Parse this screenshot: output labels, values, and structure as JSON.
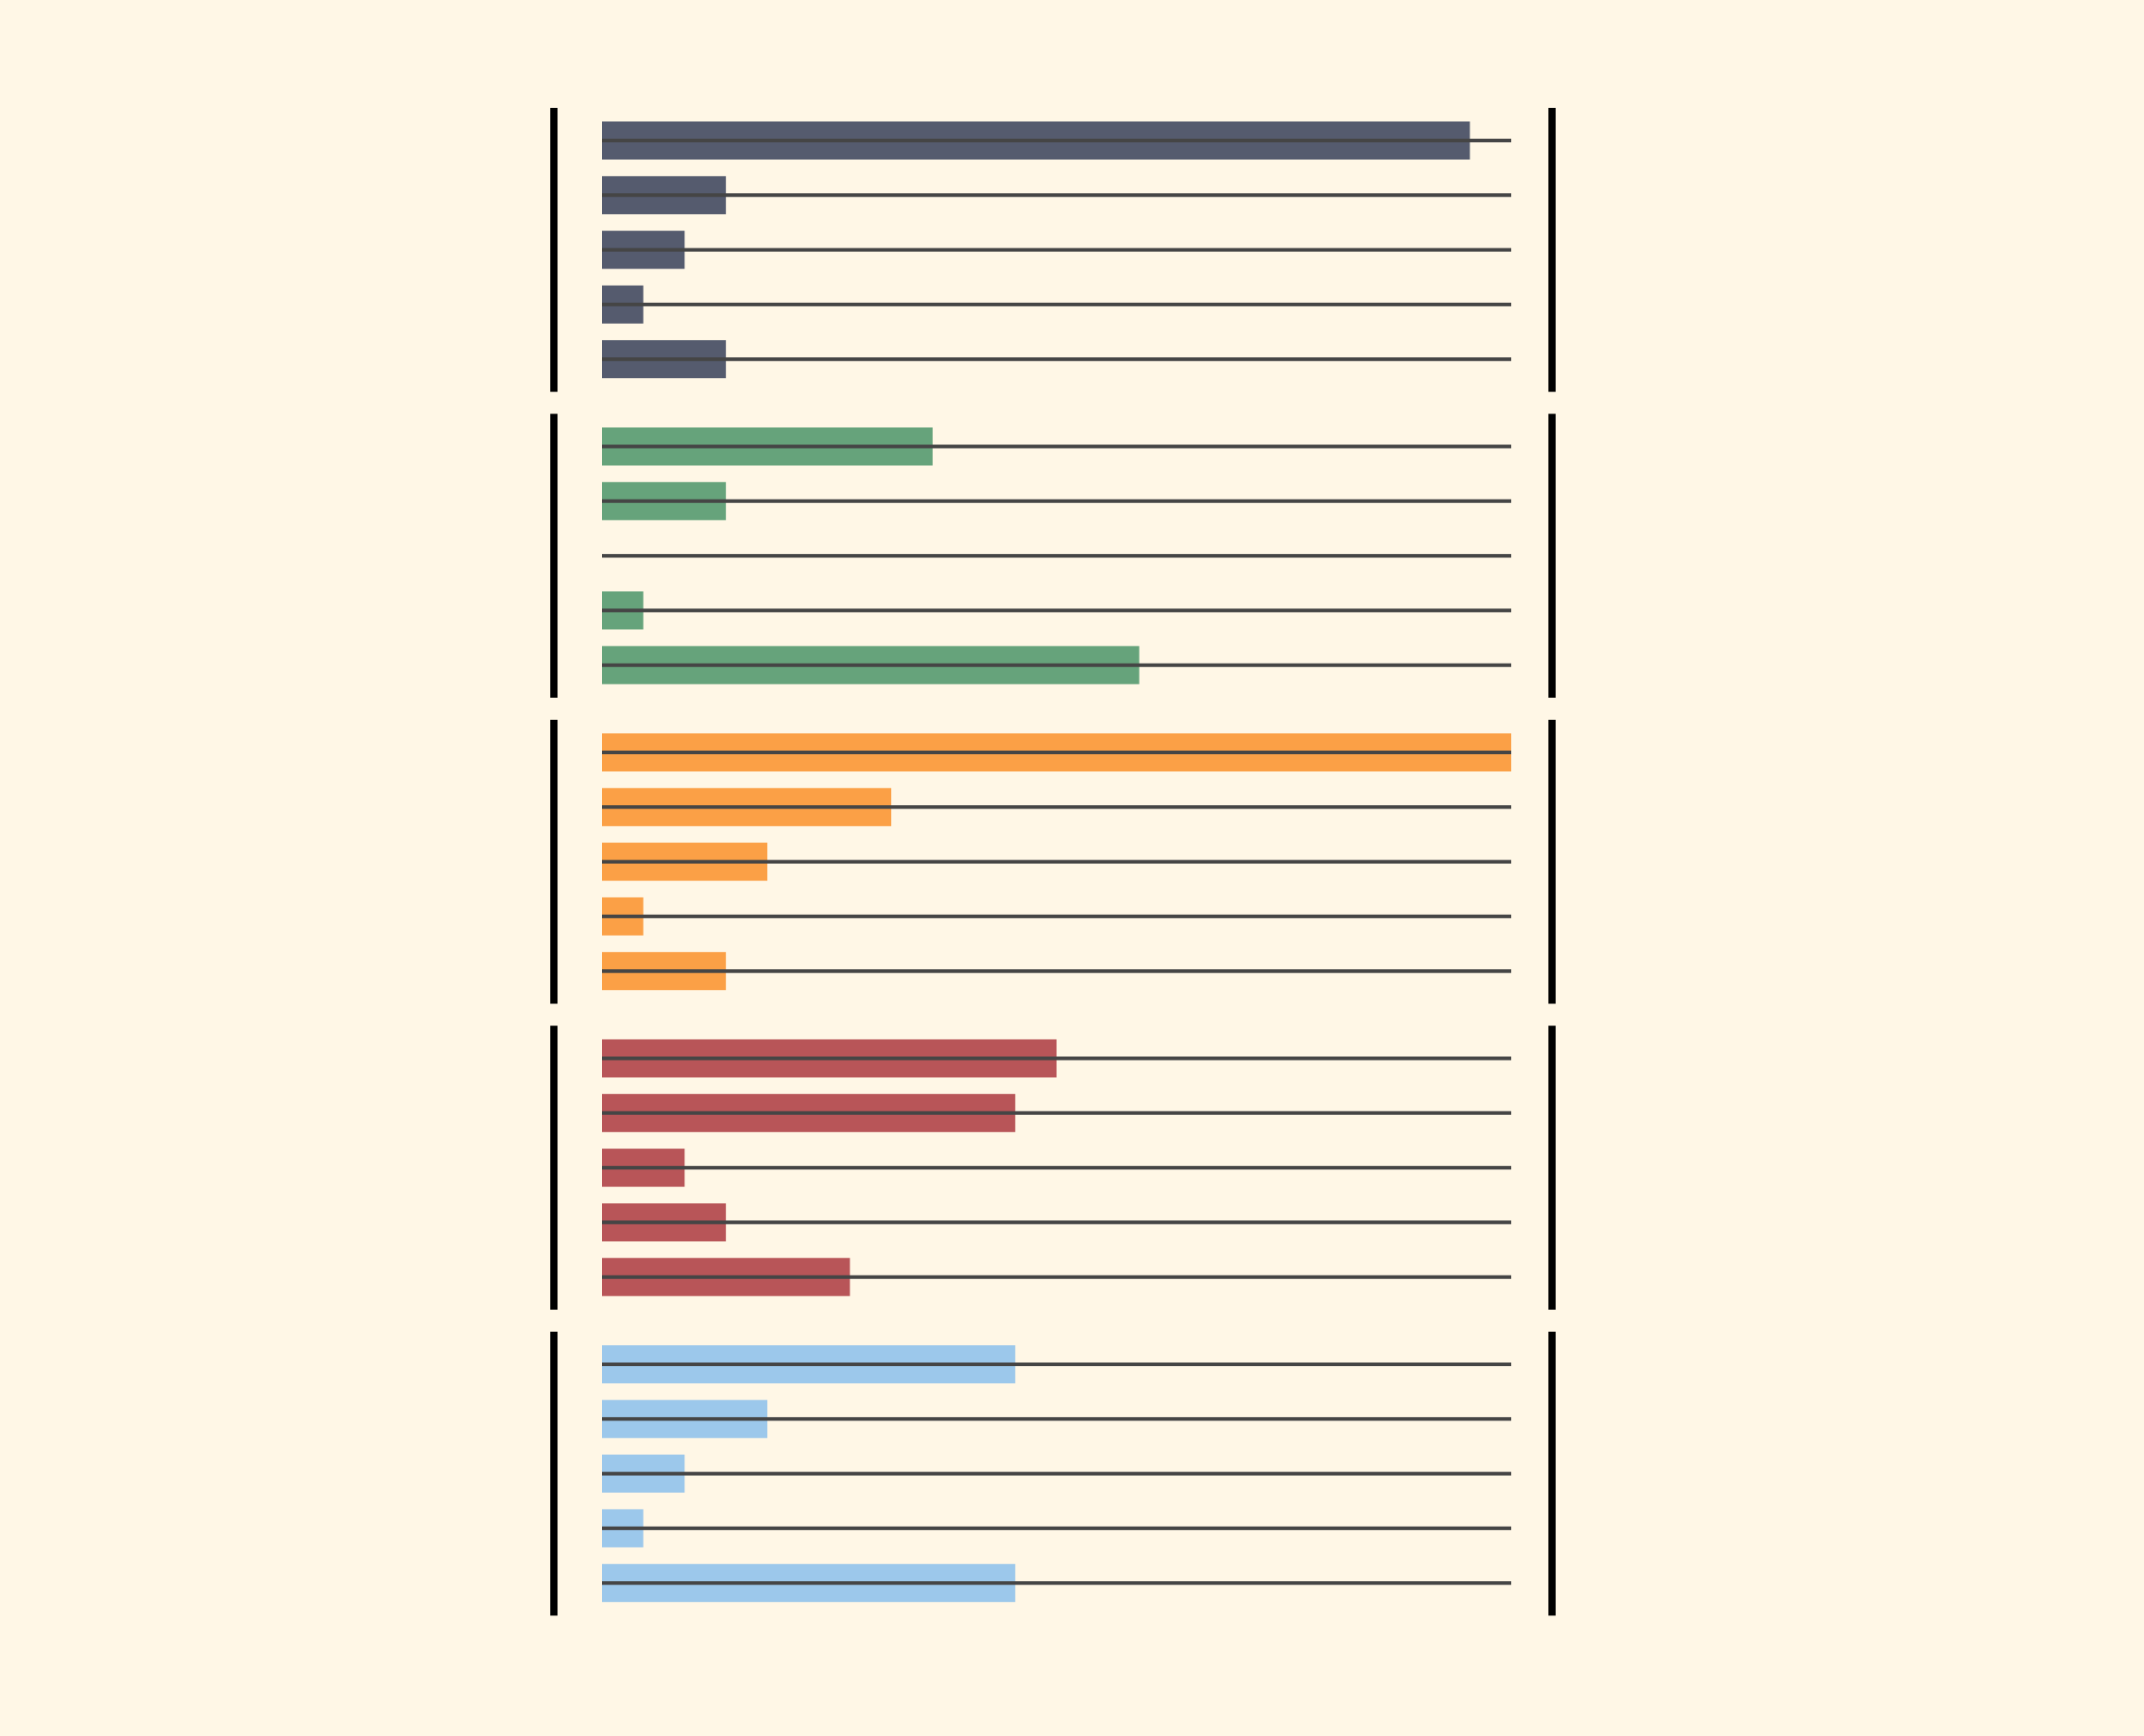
{
  "chart_data": {
    "type": "bar",
    "orientation": "horizontal",
    "title": "",
    "xlabel": "",
    "ylabel": "",
    "grid": false,
    "legend": "none",
    "xlim": [
      0,
      22
    ],
    "background_color": "#FFF7E6",
    "track_color": "#454545",
    "bracket_color": "#000000",
    "groups": [
      {
        "color": "#555B6E",
        "values": [
          21,
          3,
          2,
          1,
          3
        ]
      },
      {
        "color": "#66A37B",
        "values": [
          8,
          3,
          0,
          1,
          13
        ]
      },
      {
        "color": "#FBA046",
        "values": [
          22,
          7,
          4,
          1,
          3
        ]
      },
      {
        "color": "#B85558",
        "values": [
          11,
          10,
          2,
          3,
          6
        ]
      },
      {
        "color": "#9CC8EB",
        "values": [
          10,
          4,
          2,
          1,
          10
        ]
      }
    ]
  }
}
